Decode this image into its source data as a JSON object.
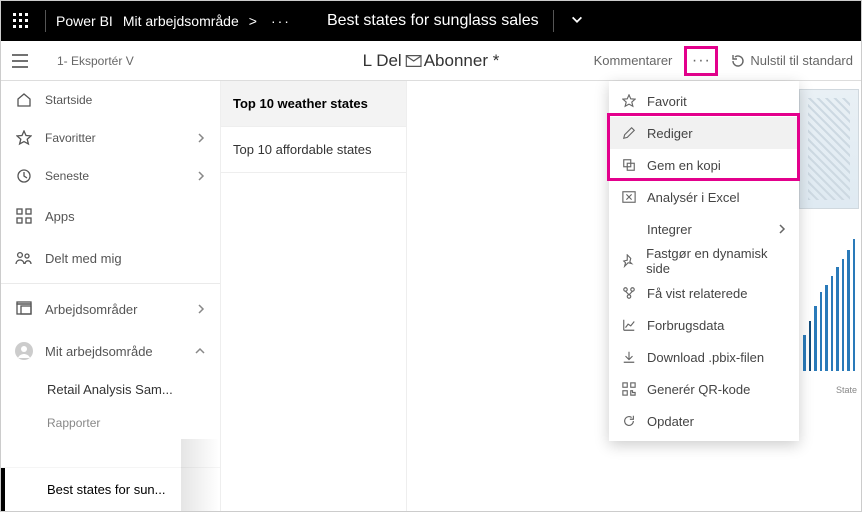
{
  "topbar": {
    "brand": "Power BI",
    "workspace": "Mit arbejdsområde",
    "chevron": ">",
    "ellipsis": "···",
    "title": "Best states for sunglass sales"
  },
  "toolbar": {
    "export": "1- Eksportér V",
    "share": "L Del",
    "subscribe": "Abonner *",
    "comments": "Kommentarer",
    "more": "···",
    "reset": "Nulstil til standard"
  },
  "nav": {
    "home": "Startside",
    "favorites": "Favoritter",
    "recent": "Seneste",
    "apps": "Apps",
    "shared": "Delt med mig",
    "workspaces": "Arbejdsområder",
    "myws": "Mit arbejdsområde",
    "sample": "Retail Analysis Sam...",
    "reports": "Rapporter",
    "bestStates": "Best states for sun..."
  },
  "pages": {
    "weather": "Top 10 weather states",
    "affordable": "Top 10 affordable states"
  },
  "menu": {
    "favorite": "Favorit",
    "edit": "Rediger",
    "saveCopy": "Gem en kopi",
    "analyze": "Analysér i Excel",
    "embed": "Integrer",
    "pin": "Fastgør en dynamisk side",
    "related": "Få vist relaterede",
    "usage": "Forbrugsdata",
    "download": "Download .pbix-filen",
    "qr": "Generér QR-kode",
    "refresh": "Opdater"
  },
  "thumb": {
    "state": "State"
  }
}
